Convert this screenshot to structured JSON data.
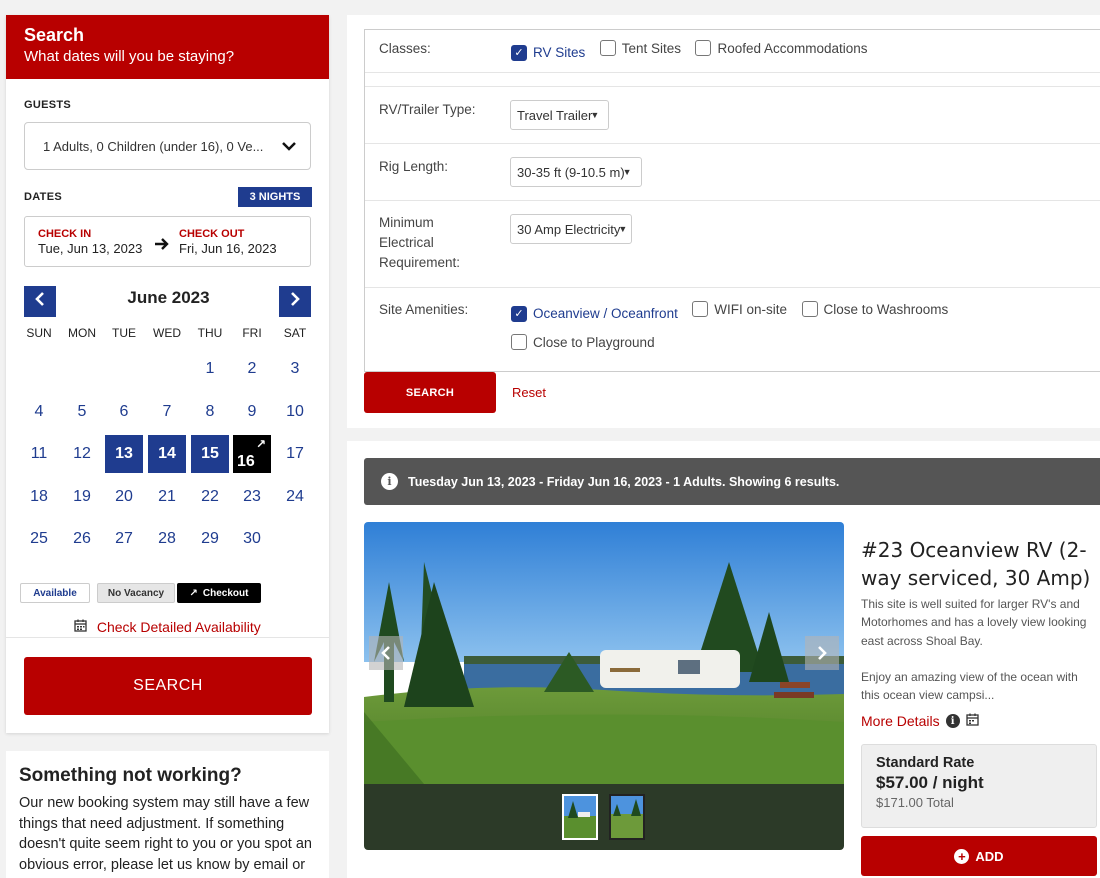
{
  "search": {
    "title": "Search",
    "subtitle": "What dates will you be staying?"
  },
  "guests": {
    "label": "GUESTS",
    "value": "1 Adults, 0 Children (under 16), 0 Ve..."
  },
  "dates": {
    "label": "DATES",
    "nights_badge": "3 NIGHTS",
    "check_in_label": "CHECK IN",
    "check_in_value": "Tue, Jun 13, 2023",
    "check_out_label": "CHECK OUT",
    "check_out_value": "Fri, Jun 16, 2023"
  },
  "calendar": {
    "month": "June 2023",
    "weekdays": [
      "SUN",
      "MON",
      "TUE",
      "WED",
      "THU",
      "FRI",
      "SAT"
    ],
    "weeks": [
      [
        "",
        "",
        "",
        "",
        "1",
        "2",
        "3"
      ],
      [
        "4",
        "5",
        "6",
        "7",
        "8",
        "9",
        "10"
      ],
      [
        "11",
        "12",
        "13",
        "14",
        "15",
        "16",
        "17"
      ],
      [
        "18",
        "19",
        "20",
        "21",
        "22",
        "23",
        "24"
      ],
      [
        "25",
        "26",
        "27",
        "28",
        "29",
        "30",
        ""
      ]
    ],
    "selected_days": [
      "13",
      "14",
      "15"
    ],
    "checkout_day": "16",
    "legend": {
      "available": "Available",
      "no_vacancy": "No Vacancy",
      "checkout": "Checkout"
    },
    "detailed_link": "Check Detailed Availability"
  },
  "left_search_button": "SEARCH",
  "info": {
    "title": "Something not working?",
    "body": "Our new booking system may still have a few things that need adjustment. If something doesn't quite seem right to you or you spot an obvious error, please let us know by email or call our office."
  },
  "filters": {
    "classes_label": "Classes:",
    "classes": [
      {
        "label": "RV Sites",
        "checked": true
      },
      {
        "label": "Tent Sites",
        "checked": false
      },
      {
        "label": "Roofed Accommodations",
        "checked": false
      }
    ],
    "rv_type_label": "RV/Trailer Type:",
    "rv_type_value": "Travel Trailer",
    "rig_length_label": "Rig Length:",
    "rig_length_value": "30-35 ft (9-10.5 m)",
    "electrical_label": "Minimum Electrical Requirement:",
    "electrical_value": "30 Amp Electricity",
    "amenities_label": "Site Amenities:",
    "amenities": [
      {
        "label": "Oceanview / Oceanfront",
        "checked": true
      },
      {
        "label": "WIFI on-site",
        "checked": false
      },
      {
        "label": "Close to Washrooms",
        "checked": false
      },
      {
        "label": "Close to Playground",
        "checked": false
      }
    ],
    "search_button": "SEARCH",
    "reset_link": "Reset"
  },
  "results": {
    "banner": "Tuesday Jun 13, 2023 - Friday Jun 16, 2023 - 1 Adults. Showing 6 results.",
    "site_title": "#23 Oceanview RV (2-way serviced, 30 Amp)",
    "description_p1": "This site is well suited for larger RV's and Motorhomes and has a lovely view looking east across Shoal Bay.",
    "description_p2": "Enjoy an amazing view of the ocean with this ocean view campsi...",
    "more_details": "More Details",
    "rate_name": "Standard Rate",
    "rate_price": "$57.00 / night",
    "rate_total": "$171.00 Total",
    "add_button": "ADD"
  },
  "colors": {
    "brand_red": "#b80000",
    "accent_blue": "#1f3c8f",
    "banner_gray": "#555555"
  },
  "icons": [
    "chevron-down-icon",
    "arrow-right-icon",
    "chevron-left-icon",
    "chevron-right-icon",
    "checkout-arrow-icon",
    "calendar-icon",
    "checkmark-icon",
    "info-icon",
    "plus-circle-icon"
  ]
}
